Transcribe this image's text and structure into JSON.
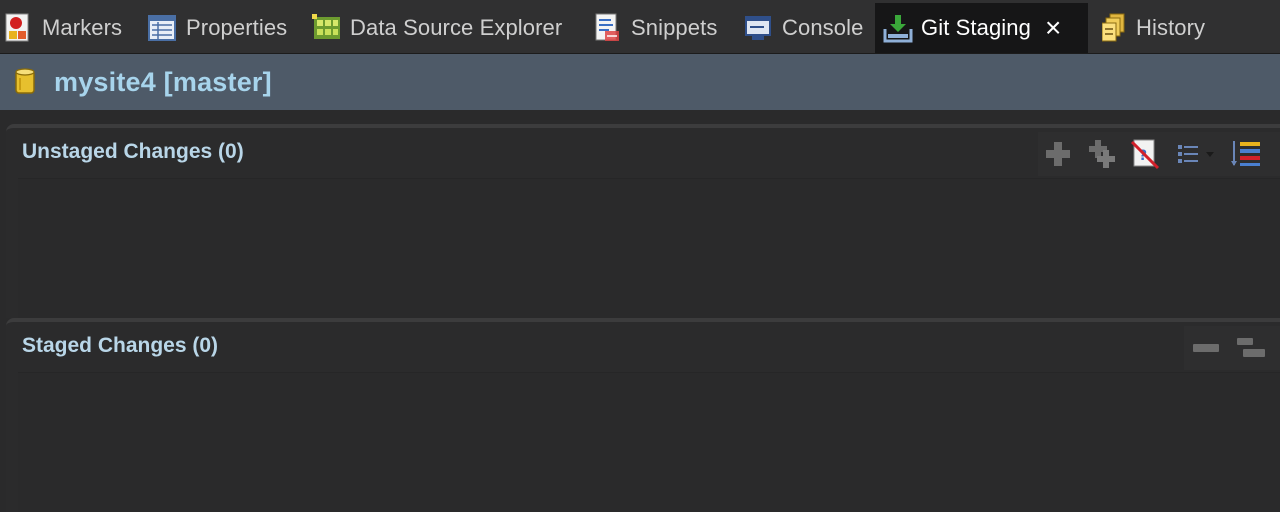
{
  "tabs": [
    {
      "label": "Markers",
      "icon": "markers-icon"
    },
    {
      "label": "Properties",
      "icon": "properties-icon"
    },
    {
      "label": "Data Source Explorer",
      "icon": "data-source-explorer-icon"
    },
    {
      "label": "Snippets",
      "icon": "snippets-icon"
    },
    {
      "label": "Console",
      "icon": "console-icon"
    },
    {
      "label": "Git Staging",
      "icon": "git-staging-icon",
      "active": true
    },
    {
      "label": "History",
      "icon": "history-icon"
    }
  ],
  "repository": {
    "name": "mysite4 [master]",
    "icon": "repository-icon"
  },
  "unstaged": {
    "title": "Unstaged Changes (0)",
    "toolbar": [
      "add-to-index-icon",
      "add-all-to-index-icon",
      "ignore-untracked-icon",
      "presentation-menu-icon",
      "sort-icon"
    ]
  },
  "staged": {
    "title": "Staged Changes (0)",
    "toolbar": [
      "collapse-all-icon",
      "expand-all-icon"
    ]
  },
  "colors": {
    "accent": "#a7d4ec",
    "header_bg": "#4e5a68",
    "panel_bg": "#2a2a2b"
  }
}
